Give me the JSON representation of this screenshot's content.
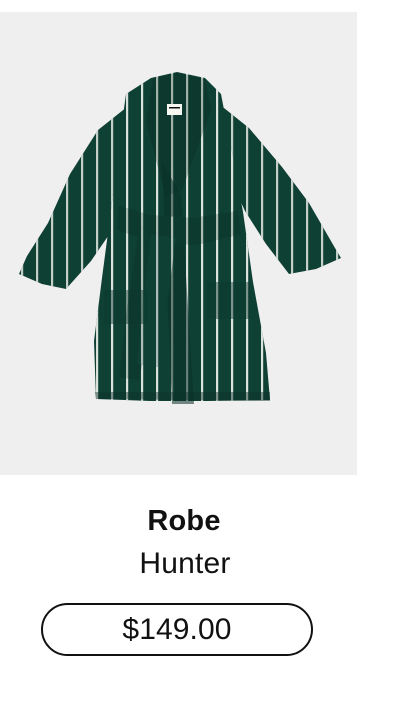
{
  "product": {
    "name": "Robe",
    "color": "Hunter",
    "price": "$149.00",
    "image": {
      "icon": "robe-image",
      "background_color": "#efefef",
      "robe_color": "#0f4034",
      "stripe_color": "#f2f3ef"
    }
  }
}
